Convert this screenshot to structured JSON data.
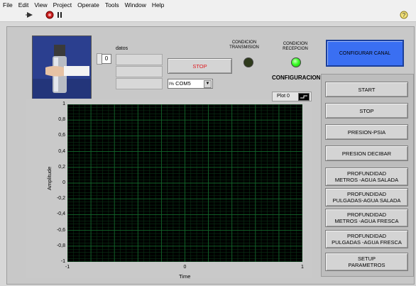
{
  "menu": [
    "File",
    "Edit",
    "View",
    "Project",
    "Operate",
    "Tools",
    "Window",
    "Help"
  ],
  "toolbar": {
    "run_icon": "run-arrow-icon",
    "abort_icon": "abort-icon",
    "pause_icon": "pause-icon",
    "help_icon": "help-icon"
  },
  "datos": {
    "label": "datos",
    "index_value": "0"
  },
  "stop_top": {
    "label": "STOP"
  },
  "com_port": {
    "prefix": "I%",
    "value": "COM5"
  },
  "condicion_transmision": {
    "label_line1": "CONDICION",
    "label_line2": "TRANSMISION",
    "color": "#2f3b1d"
  },
  "condicion_recepcion": {
    "label_line1": "CONDICION",
    "label_line2": "RECEPCION",
    "color": "#39ff26"
  },
  "configurar_canal": {
    "label": "CONFIGURAR CANAL"
  },
  "configuracion_title": "CONFIGURACION",
  "side_buttons": [
    {
      "line1": "START",
      "line2": ""
    },
    {
      "line1": "STOP",
      "line2": ""
    },
    {
      "line1": "PRESION-PSIA",
      "line2": ""
    },
    {
      "line1": "PRESION DECIBAR",
      "line2": ""
    },
    {
      "line1": "PROFUNDIDAD",
      "line2": "METROS -AGUA SALADA"
    },
    {
      "line1": "PROFUNDIDAD",
      "line2": "PULGADAS-AGUA SALADA"
    },
    {
      "line1": "PROFUNDIDAD",
      "line2": "METROS -AGUA FRESCA"
    },
    {
      "line1": "PROFUNDIDAD",
      "line2": "PULGADAS -AGUA FRESCA"
    },
    {
      "line1": "SETUP",
      "line2": "PARAMETROS"
    }
  ],
  "chart_data": {
    "type": "line",
    "title": "",
    "legend": [
      "Plot 0"
    ],
    "xlabel": "Time",
    "ylabel": "Amplitude",
    "xlim": [
      -1,
      1
    ],
    "ylim": [
      -1,
      1
    ],
    "x_ticks": [
      "-1",
      "0",
      "1"
    ],
    "y_ticks": [
      "1",
      "0,8",
      "0,6",
      "0,4",
      "0,2",
      "0",
      "-0,2",
      "-0,4",
      "-0,6",
      "-0,8",
      "-1"
    ],
    "grid": true,
    "series": []
  }
}
